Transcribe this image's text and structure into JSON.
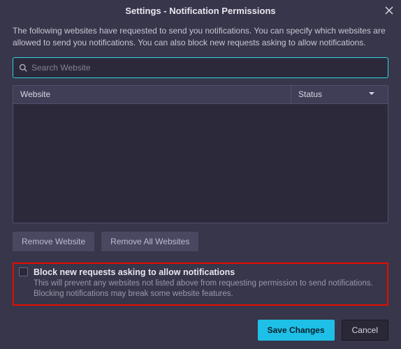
{
  "title": "Settings - Notification Permissions",
  "description": "The following websites have requested to send you notifications. You can specify which websites are allowed to send you notifications. You can also block new requests asking to allow notifications.",
  "search": {
    "placeholder": "Search Website",
    "value": ""
  },
  "table": {
    "headers": {
      "website": "Website",
      "status": "Status"
    },
    "rows": []
  },
  "buttons": {
    "remove_website": "Remove Website",
    "remove_all": "Remove All Websites",
    "save": "Save Changes",
    "cancel": "Cancel"
  },
  "block_new": {
    "label": "Block new requests asking to allow notifications",
    "description": "This will prevent any websites not listed above from requesting permission to send notifications. Blocking notifications may break some website features.",
    "checked": false
  }
}
